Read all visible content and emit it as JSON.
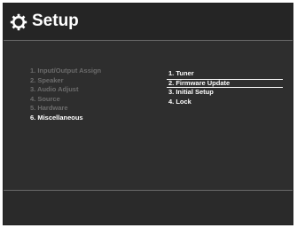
{
  "header": {
    "title": "Setup",
    "icon": "gear-icon"
  },
  "menu": {
    "items": [
      {
        "label": "1. Input/Output Assign",
        "active": false
      },
      {
        "label": "2. Speaker",
        "active": false
      },
      {
        "label": "3. Audio Adjust",
        "active": false
      },
      {
        "label": "4. Source",
        "active": false
      },
      {
        "label": "5. Hardware",
        "active": false
      },
      {
        "label": "6. Miscellaneous",
        "active": true
      }
    ]
  },
  "submenu": {
    "items": [
      {
        "label": "1. Tuner",
        "selected": false
      },
      {
        "label": "2. Firmware Update",
        "selected": true
      },
      {
        "label": "3. Initial Setup",
        "selected": false
      },
      {
        "label": "4. Lock",
        "selected": false
      }
    ]
  },
  "colors": {
    "background": "#2e2e2e",
    "active_text": "#ffffff",
    "inactive_text": "#6c6c6c"
  }
}
